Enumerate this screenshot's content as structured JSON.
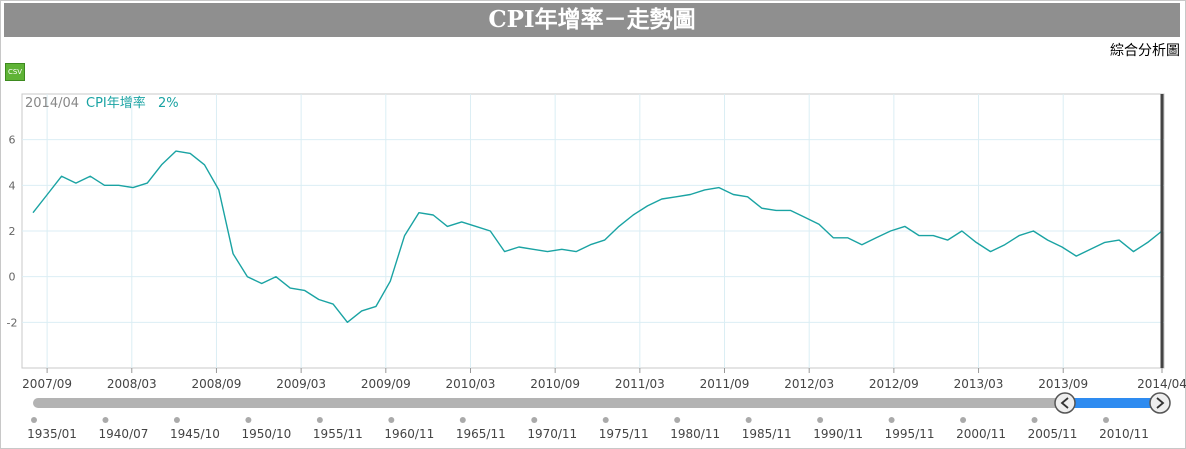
{
  "header": {
    "title": "CPI年增率－走勢圖"
  },
  "analysis_link": "綜合分析圖",
  "csv_label": "CSV",
  "readout": {
    "date": "2014/04",
    "series": "CPI年增率",
    "value": "2%"
  },
  "colors": {
    "line": "#1aa3a3",
    "title_bg": "#8f8f8f",
    "nav_fill": "#2e8bf0",
    "grid": "#dbeef4"
  },
  "chart_data": {
    "type": "line",
    "title": "CPI年增率－走勢圖",
    "xlabel": "",
    "ylabel": "",
    "ylim": [
      -4,
      8
    ],
    "yticks": [
      -2,
      0,
      2,
      4,
      6
    ],
    "grid": true,
    "x_tick_labels": [
      "2007/09",
      "2008/03",
      "2008/09",
      "2009/03",
      "2009/09",
      "2010/03",
      "2010/09",
      "2011/03",
      "2011/09",
      "2012/03",
      "2012/09",
      "2013/03",
      "2013/09",
      "2014/04"
    ],
    "x_start": "2007/08",
    "x_end": "2014/04",
    "series": [
      {
        "name": "CPI年增率",
        "values": [
          2.8,
          3.6,
          4.4,
          4.1,
          4.4,
          4.0,
          4.0,
          3.9,
          4.1,
          4.9,
          5.5,
          5.4,
          4.9,
          3.8,
          1.0,
          0.0,
          -0.3,
          0.0,
          -0.5,
          -0.6,
          -1.0,
          -1.2,
          -2.0,
          -1.5,
          -1.3,
          -0.2,
          1.8,
          2.8,
          2.7,
          2.2,
          2.4,
          2.2,
          2.0,
          1.1,
          1.3,
          1.2,
          1.1,
          1.2,
          1.1,
          1.4,
          1.6,
          2.2,
          2.7,
          3.1,
          3.4,
          3.5,
          3.6,
          3.8,
          3.9,
          3.6,
          3.5,
          3.0,
          2.9,
          2.9,
          2.6,
          2.3,
          1.7,
          1.7,
          1.4,
          1.7,
          2.0,
          2.2,
          1.8,
          1.8,
          1.6,
          2.0,
          1.5,
          1.1,
          1.4,
          1.8,
          2.0,
          1.6,
          1.3,
          0.9,
          1.2,
          1.5,
          1.6,
          1.1,
          1.5,
          2.0
        ]
      }
    ],
    "navigator": {
      "tick_labels": [
        "1935/01",
        "1940/07",
        "1945/10",
        "1950/10",
        "1955/11",
        "1960/11",
        "1965/11",
        "1970/11",
        "1975/11",
        "1980/11",
        "1985/11",
        "1990/11",
        "1995/11",
        "2000/11",
        "2005/11",
        "2010/11"
      ]
    }
  }
}
